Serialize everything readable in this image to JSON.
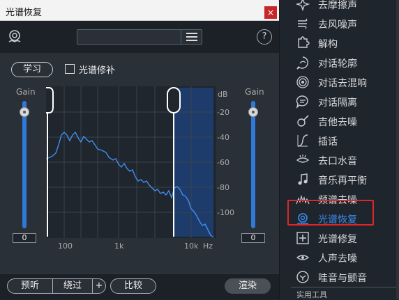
{
  "window": {
    "title": "光谱恢复",
    "close_glyph": "×"
  },
  "toolbar": {
    "preset_value": "",
    "help_glyph": "?"
  },
  "controls": {
    "learn_label": "学习",
    "spectral_patch_label": "光谱修补"
  },
  "left_gain": {
    "label": "Gain",
    "value": "0",
    "level": 0
  },
  "right_gain": {
    "label": "Gain",
    "value": "0",
    "level": 0
  },
  "graph": {
    "db_unit": "dB",
    "db_ticks": [
      "-20",
      "-40",
      "-60",
      "-80",
      "-100"
    ],
    "freq_ticks": [
      "100",
      "1k",
      "10k"
    ],
    "freq_unit": "Hz",
    "highlight_color": "#1d3c6b",
    "curve_color": "#3f8ff0"
  },
  "bottom": {
    "preview_label": "预听",
    "bypass_label": "绕过",
    "plus_label": "+",
    "compare_label": "比较",
    "render_label": "渲染"
  },
  "modules": [
    {
      "label": "去摩擦声",
      "icon": "sparkle-icon"
    },
    {
      "label": "去风噪声",
      "icon": "wind-icon"
    },
    {
      "label": "解构",
      "icon": "puzzle-icon"
    },
    {
      "label": "对话轮廓",
      "icon": "dialogue-contour-icon"
    },
    {
      "label": "对话去混响",
      "icon": "reverb-icon"
    },
    {
      "label": "对话隔离",
      "icon": "speech-bubble-icon"
    },
    {
      "label": "吉他去噪",
      "icon": "guitar-icon"
    },
    {
      "label": "插话",
      "icon": "interpolate-icon"
    },
    {
      "label": "去口水音",
      "icon": "mouth-icon"
    },
    {
      "label": "音乐再平衡",
      "icon": "music-note-icon"
    },
    {
      "label": "频谱去噪",
      "icon": "spectral-icon"
    },
    {
      "label": "光谱恢复",
      "icon": "lifebuoy-icon",
      "selected": true
    },
    {
      "label": "光谱修复",
      "icon": "repair-icon"
    },
    {
      "label": "人声去噪",
      "icon": "voice-icon"
    },
    {
      "label": "哇音与颤音",
      "icon": "wow-icon"
    }
  ],
  "footer": {
    "label": "实用工具"
  },
  "colors": {
    "accent": "#3d8cf0",
    "highlight_border": "#e0262a",
    "slider": "#2f79d8"
  }
}
